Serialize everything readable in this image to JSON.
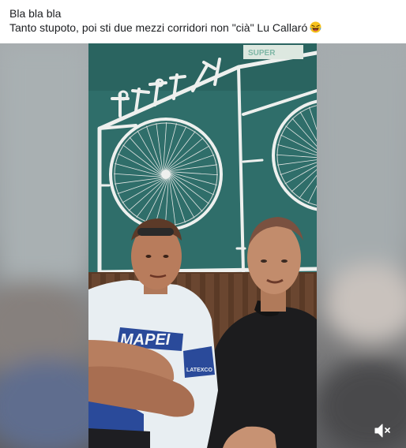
{
  "post": {
    "caption_line1": "Bla bla bla",
    "caption_line2": "Tanto stupoto, poi sti due mezzi corridori non \"cià\" Lu Callaró",
    "caption_emoji": "laughing-crying-emoji"
  },
  "video": {
    "wall_sign_text": "SUPER",
    "jersey_text": "MAPEI",
    "sleeve_text": "LATEXCO",
    "controls": {
      "volume_icon": "muted-speaker-icon"
    }
  },
  "colors": {
    "wall_teal": "#2f6e6a",
    "frame_white": "#eef0ee",
    "jersey_blue": "#2a4a9a",
    "dark_shirt": "#1c1c1e",
    "background_blur": "#9ea3a6"
  }
}
